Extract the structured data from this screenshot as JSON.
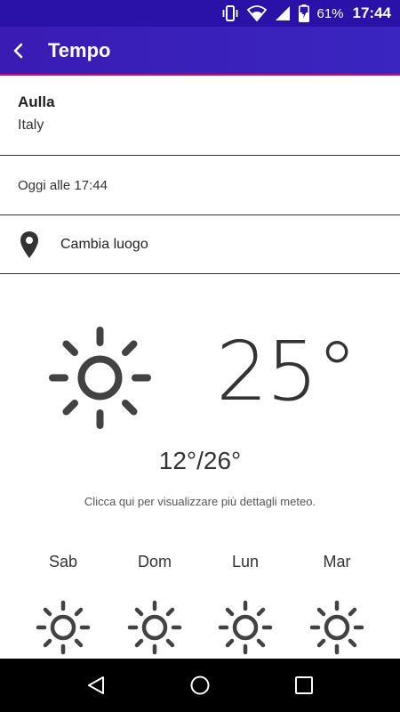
{
  "status_bar": {
    "battery_percent": "61%",
    "time": "17:44",
    "icons": [
      "vibrate-icon",
      "wifi-icon",
      "signal-icon",
      "battery-charging-icon"
    ]
  },
  "app_bar": {
    "title": "Tempo",
    "back_icon": "back-arrow-icon"
  },
  "location": {
    "city": "Aulla",
    "country": "Italy"
  },
  "updated": "Oggi alle 17:44",
  "change_location": {
    "label": "Cambia luogo",
    "icon": "location-pin-icon"
  },
  "current": {
    "icon": "sun-icon",
    "temperature": "25°",
    "minmax": "12°/26°",
    "details_hint": "Clicca qui per visualizzare più dettagli meteo."
  },
  "forecast": [
    {
      "day": "Sab",
      "icon": "sun-icon"
    },
    {
      "day": "Dom",
      "icon": "sun-icon"
    },
    {
      "day": "Lun",
      "icon": "sun-icon"
    },
    {
      "day": "Mar",
      "icon": "sun-icon"
    }
  ],
  "colors": {
    "status_bar": "#2a12a8",
    "app_bar": "#3a1bb4",
    "accent_line": "#c2185b",
    "icon_gray": "#424242"
  },
  "nav_bar": {
    "icons": [
      "nav-back-icon",
      "nav-home-icon",
      "nav-recents-icon"
    ]
  }
}
